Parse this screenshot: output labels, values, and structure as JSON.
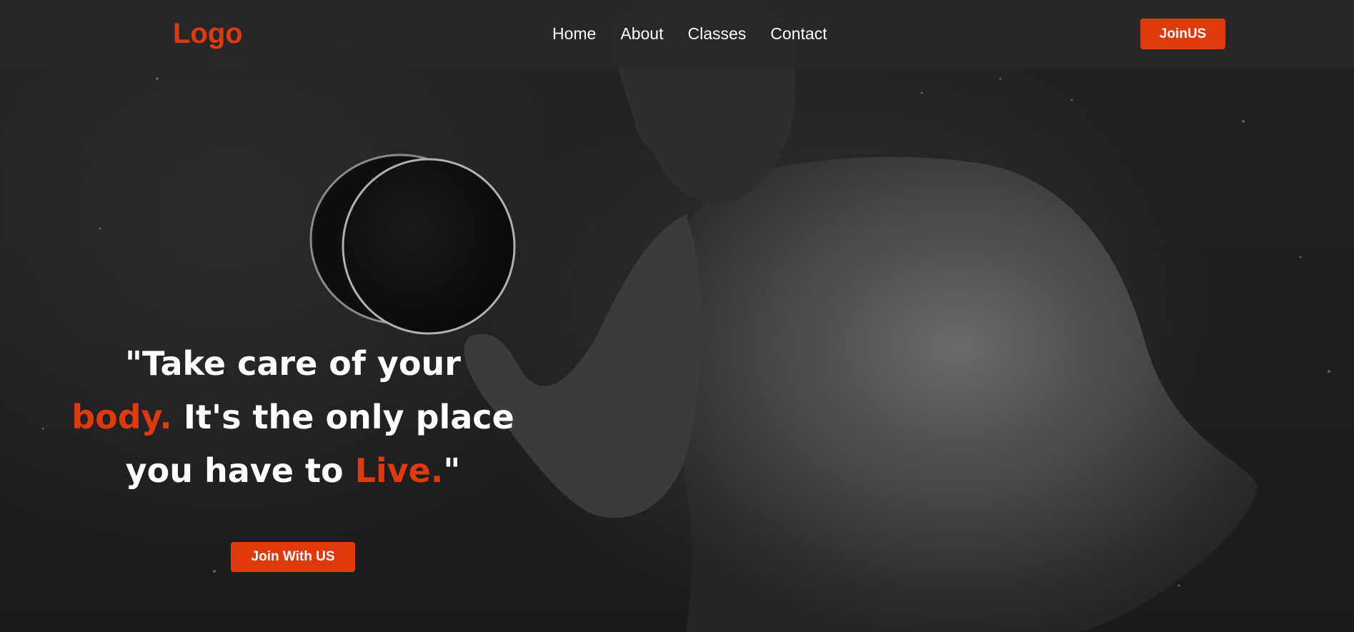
{
  "header": {
    "logo": "Logo",
    "nav": [
      {
        "label": "Home"
      },
      {
        "label": "About"
      },
      {
        "label": "Classes"
      },
      {
        "label": "Contact"
      }
    ],
    "join_label": "JoinUS"
  },
  "hero": {
    "quote_open": "\"Take care of your ",
    "quote_accent1": "body.",
    "quote_mid": "It's the only place you have to ",
    "quote_accent2": "Live.",
    "quote_close": "\"",
    "cta_label": "Join With US"
  },
  "colors": {
    "accent": "#e03a0c",
    "navbar": "#28282a",
    "text": "#ffffff"
  }
}
